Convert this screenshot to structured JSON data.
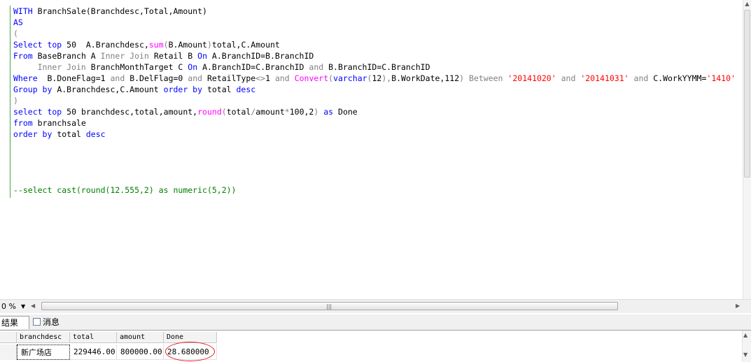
{
  "editor": {
    "lines": [
      [
        {
          "c": "kw",
          "t": "WITH"
        },
        {
          "c": "",
          "t": " BranchSale(Branchdesc,Total,Amount)"
        }
      ],
      [
        {
          "c": "kw",
          "t": "AS"
        }
      ],
      [
        {
          "c": "gr",
          "t": "("
        }
      ],
      [
        {
          "c": "kw",
          "t": "Select top"
        },
        {
          "c": "",
          "t": " 50  A.Branchdesc,"
        },
        {
          "c": "fn",
          "t": "sum"
        },
        {
          "c": "gr",
          "t": "("
        },
        {
          "c": "",
          "t": "B.Amount"
        },
        {
          "c": "gr",
          "t": ")"
        },
        {
          "c": "",
          "t": "total,C.Amount"
        }
      ],
      [
        {
          "c": "kw",
          "t": "From"
        },
        {
          "c": "",
          "t": " BaseBranch A "
        },
        {
          "c": "gr",
          "t": "Inner Join"
        },
        {
          "c": "",
          "t": " Retail B "
        },
        {
          "c": "kw",
          "t": "On"
        },
        {
          "c": "",
          "t": " A.BranchID=B.BranchID"
        }
      ],
      [
        {
          "c": "",
          "t": "     "
        },
        {
          "c": "gr",
          "t": "Inner Join"
        },
        {
          "c": "",
          "t": " BranchMonthTarget C "
        },
        {
          "c": "kw",
          "t": "On"
        },
        {
          "c": "",
          "t": " A.BranchID=C.BranchID "
        },
        {
          "c": "gr",
          "t": "and"
        },
        {
          "c": "",
          "t": " B.BranchID=C.BranchID"
        }
      ],
      [
        {
          "c": "kw",
          "t": "Where"
        },
        {
          "c": "",
          "t": "  B.DoneFlag=1 "
        },
        {
          "c": "gr",
          "t": "and"
        },
        {
          "c": "",
          "t": " B.DelFlag=0 "
        },
        {
          "c": "gr",
          "t": "and"
        },
        {
          "c": "",
          "t": " RetailType"
        },
        {
          "c": "gr",
          "t": "<>"
        },
        {
          "c": "",
          "t": "1 "
        },
        {
          "c": "gr",
          "t": "and"
        },
        {
          "c": "",
          "t": " "
        },
        {
          "c": "fn",
          "t": "Convert"
        },
        {
          "c": "gr",
          "t": "("
        },
        {
          "c": "kw",
          "t": "varchar"
        },
        {
          "c": "gr",
          "t": "("
        },
        {
          "c": "",
          "t": "12"
        },
        {
          "c": "gr",
          "t": "),"
        },
        {
          "c": "",
          "t": "B.WorkDate,112"
        },
        {
          "c": "gr",
          "t": ")"
        },
        {
          "c": "",
          "t": " "
        },
        {
          "c": "gr",
          "t": "Between"
        },
        {
          "c": "",
          "t": " "
        },
        {
          "c": "st",
          "t": "'20141020'"
        },
        {
          "c": "",
          "t": " "
        },
        {
          "c": "gr",
          "t": "and"
        },
        {
          "c": "",
          "t": " "
        },
        {
          "c": "st",
          "t": "'20141031'"
        },
        {
          "c": "",
          "t": " "
        },
        {
          "c": "gr",
          "t": "and"
        },
        {
          "c": "",
          "t": " C.WorkYYMM="
        },
        {
          "c": "st",
          "t": "'1410'"
        }
      ],
      [
        {
          "c": "kw",
          "t": "Group by"
        },
        {
          "c": "",
          "t": " A.Branchdesc,C.Amount "
        },
        {
          "c": "kw",
          "t": "order by"
        },
        {
          "c": "",
          "t": " total "
        },
        {
          "c": "kw",
          "t": "desc"
        }
      ],
      [
        {
          "c": "gr",
          "t": ")"
        }
      ],
      [
        {
          "c": "kw",
          "t": "select top"
        },
        {
          "c": "",
          "t": " 50 branchdesc,total,amount,"
        },
        {
          "c": "fn",
          "t": "round"
        },
        {
          "c": "gr",
          "t": "("
        },
        {
          "c": "",
          "t": "total"
        },
        {
          "c": "gr",
          "t": "/"
        },
        {
          "c": "",
          "t": "amount"
        },
        {
          "c": "gr",
          "t": "*"
        },
        {
          "c": "",
          "t": "100,2"
        },
        {
          "c": "gr",
          "t": ")"
        },
        {
          "c": "",
          "t": " "
        },
        {
          "c": "kw",
          "t": "as"
        },
        {
          "c": "",
          "t": " Done"
        }
      ],
      [
        {
          "c": "kw",
          "t": "from"
        },
        {
          "c": "",
          "t": " branchsale"
        }
      ],
      [
        {
          "c": "kw",
          "t": "order by"
        },
        {
          "c": "",
          "t": " total "
        },
        {
          "c": "kw",
          "t": "desc"
        }
      ],
      [],
      [],
      [],
      [],
      [
        {
          "c": "cm",
          "t": "--select cast(round(12.555,2) as numeric(5,2))"
        }
      ]
    ]
  },
  "status": {
    "zoom_label": "0 %",
    "zoom_arrow": "▼",
    "hscroll_left": "◀",
    "hscroll_right": "▶",
    "hscroll_grip": "|||",
    "vscroll_up": "▲"
  },
  "tabs": {
    "results_label": "结果",
    "messages_label": "消息"
  },
  "grid": {
    "columns": [
      "branchdesc",
      "total",
      "amount",
      "Done"
    ],
    "rows": [
      [
        "新广场店",
        "229446.00",
        "800000.00",
        "28.680000"
      ]
    ],
    "scroll_up": "▲",
    "scroll_down": "▼"
  },
  "colors": {
    "keyword": "#0000ff",
    "operator": "#808080",
    "function": "#ff00ff",
    "string": "#ff0000",
    "comment": "#008000",
    "highlight_circle": "#e02020"
  }
}
